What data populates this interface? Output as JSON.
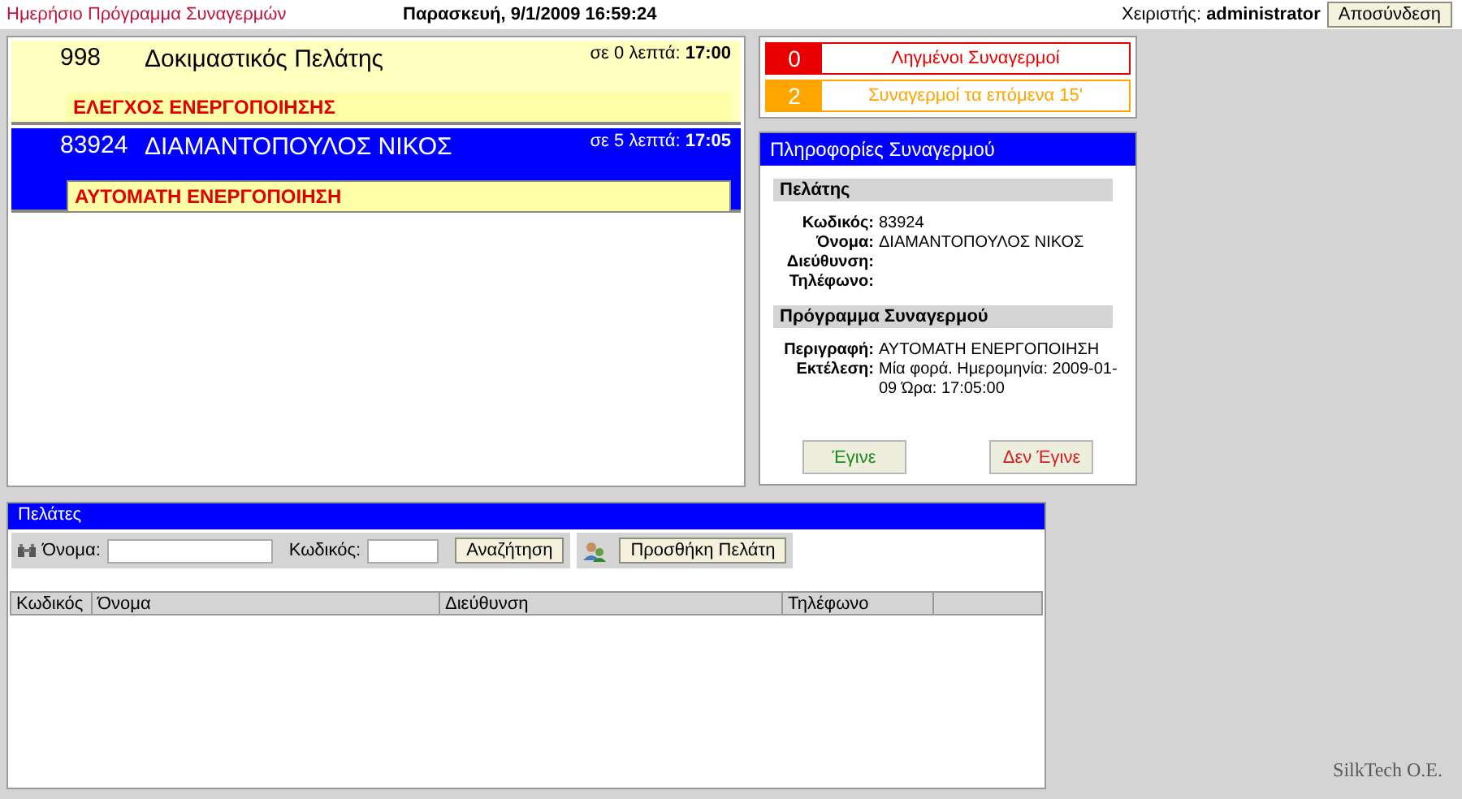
{
  "header": {
    "title": "Ημερήσιο Πρόγραμμα Συναγερμών",
    "datetime": "Παρασκευή, 9/1/2009 16:59:24",
    "user_label": "Χειριστής:",
    "user": "administrator",
    "logout_button": "Αποσύνδεση"
  },
  "alarms": [
    {
      "code": "998",
      "name": "Δοκιμαστικός Πελάτης",
      "due_prefix": "σε 0 λεπτά:",
      "due_time": "17:00",
      "action": "ΕΛΕΓΧΟΣ ΕΝΕΡΓΟΠΟΙΗΣΗΣ",
      "selected": false
    },
    {
      "code": "83924",
      "name": "ΔΙΑΜΑΝΤΟΠΟΥΛΟΣ ΝΙΚΟΣ",
      "due_prefix": "σε 5 λεπτά:",
      "due_time": "17:05",
      "action": "ΑΥΤΟΜΑΤΗ ΕΝΕΡΓΟΠΟΙΗΣΗ",
      "selected": true
    }
  ],
  "counters": [
    {
      "count": "0",
      "label": "Ληγμένοι Συναγερμοί",
      "color": "#e80000"
    },
    {
      "count": "2",
      "label": "Συναγερμοί τα επόμενα 15'",
      "color": "#ffa500"
    }
  ],
  "alarm_info": {
    "title": "Πληροφορίες Συναγερμού",
    "sections": [
      {
        "heading": "Πελάτης",
        "fields": [
          {
            "label": "Κωδικός:",
            "value": "83924"
          },
          {
            "label": "Όνομα:",
            "value": "ΔΙΑΜΑΝΤΟΠΟΥΛΟΣ ΝΙΚΟΣ"
          },
          {
            "label": "Διεύθυνση:"
          },
          {
            "label": "Τηλέφωνο:"
          }
        ]
      },
      {
        "heading": "Πρόγραμμα Συναγερμού",
        "fields": [
          {
            "label": "Περιγραφή:",
            "value": "ΑΥΤΟΜΑΤΗ ΕΝΕΡΓΟΠΟΙΗΣΗ"
          },
          {
            "label": "Εκτέλεση:",
            "value": "Μία φορά. Ημερομηνία: 2009-01-09 Ώρα: 17:05:00"
          }
        ]
      }
    ],
    "done_button": "Έγινε",
    "not_done_button": "Δεν Έγινε"
  },
  "customers": {
    "title": "Πελάτες",
    "name_label": "Όνομα:",
    "code_label": "Κωδικός:",
    "search_button": "Αναζήτηση",
    "add_button": "Προσθήκη Πελάτη",
    "columns": [
      "Κωδικός",
      "Όνομα",
      "Διεύθυνση",
      "Τηλέφωνο"
    ]
  },
  "footer": "SilkTech O.E."
}
